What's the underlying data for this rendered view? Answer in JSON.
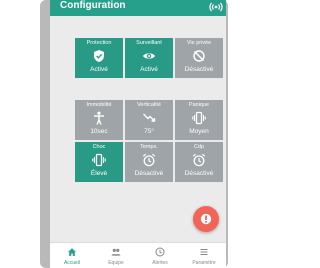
{
  "appbar": {
    "title": "Configuration",
    "icon": "broadcast-icon"
  },
  "groups": [
    {
      "tiles": [
        {
          "name": "Protection",
          "value": "Activé",
          "icon": "shield-check-icon",
          "state": "on"
        },
        {
          "name": "Surveillant",
          "value": "Activé",
          "icon": "eye-icon",
          "state": "on"
        },
        {
          "name": "Vie privée",
          "value": "Désactivé",
          "icon": "no-location-icon",
          "state": "off"
        }
      ]
    },
    {
      "tiles": [
        {
          "name": "Immobilité",
          "value": "10sec",
          "icon": "person-standing-icon",
          "state": "off"
        },
        {
          "name": "Verticalité",
          "value": "75°",
          "icon": "trending-down-icon",
          "state": "off"
        },
        {
          "name": "Panique",
          "value": "Moyen",
          "icon": "vibration-icon",
          "state": "off"
        },
        {
          "name": "Choc",
          "value": "Élevé",
          "icon": "vibration-icon",
          "state": "on"
        },
        {
          "name": "Temps.",
          "value": "Désactivé",
          "icon": "alarm-clock-icon",
          "state": "off"
        },
        {
          "name": "Cdp",
          "value": "Désactivé",
          "icon": "alarm-clock-icon",
          "state": "off"
        }
      ]
    }
  ],
  "fab": {
    "icon": "sos-alert-icon"
  },
  "nav": [
    {
      "label": "Accueil",
      "icon": "home-icon",
      "active": true
    },
    {
      "label": "Equipe",
      "icon": "team-icon",
      "active": false
    },
    {
      "label": "Alertes",
      "icon": "clock-icon",
      "active": false
    },
    {
      "label": "Paramètre",
      "icon": "menu-icon",
      "active": false
    }
  ],
  "colors": {
    "primary": "#26a08a",
    "tile_on": "#289a85",
    "tile_off": "#9ea4a8",
    "fab": "#f26457",
    "background": "#ebebeb"
  }
}
